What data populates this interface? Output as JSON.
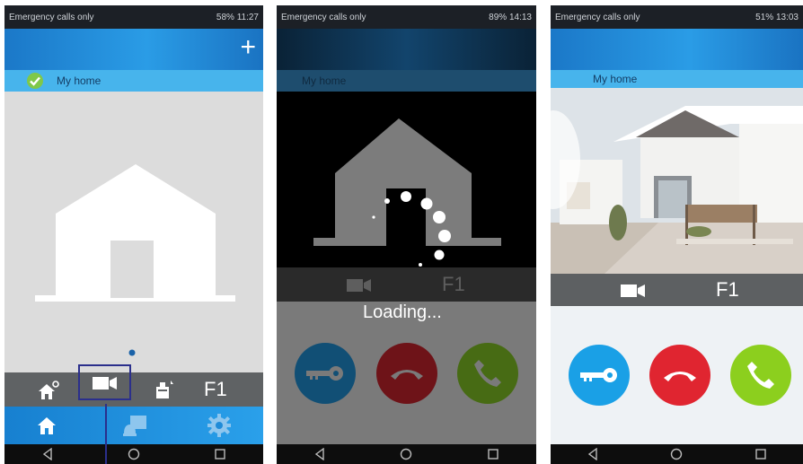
{
  "screens": [
    {
      "status": {
        "left": "Emergency calls only",
        "right": "58% 11:27"
      },
      "home_label": "My home",
      "add_icon": "+",
      "floor_label": "F1",
      "colors": {
        "header": "#1f86d4",
        "homebar": "#47b4ec",
        "content": "#dcdcdc",
        "toolbar": "#5f6264",
        "tabbar": "#2090d8"
      }
    },
    {
      "status": {
        "left": "Emergency calls only",
        "right": "89% 14:13"
      },
      "home_label": "My home",
      "floor_label": "F1",
      "loading_text": "Loading...",
      "colors": {
        "overlay": "rgba(0,0,0,0.55)"
      }
    },
    {
      "status": {
        "left": "Emergency calls only",
        "right": "51% 13:03"
      },
      "home_label": "My home",
      "floor_label": "F1",
      "colors": {
        "unlock": "#1aa0e6",
        "hangup": "#e02530",
        "answer": "#8ccf1e"
      }
    }
  ]
}
